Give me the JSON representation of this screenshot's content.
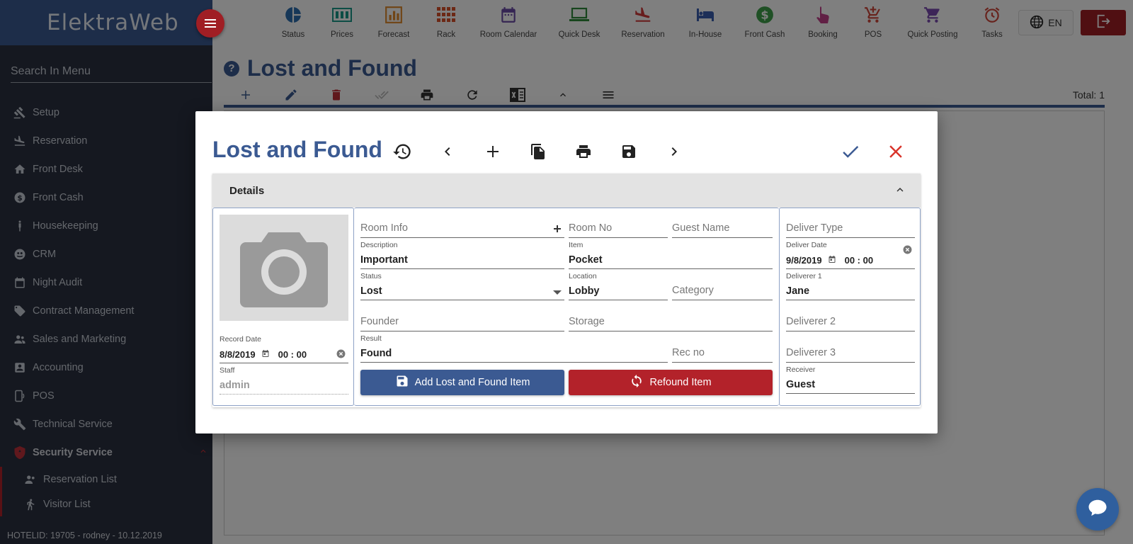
{
  "brand": {
    "name": "ElektraWeb"
  },
  "sidebar": {
    "search_placeholder": "Search In Menu",
    "items": [
      {
        "label": "Setup",
        "icon": "gavel-icon"
      },
      {
        "label": "Reservation",
        "icon": "plane-landing-icon"
      },
      {
        "label": "Front Desk",
        "icon": "home-icon"
      },
      {
        "label": "Front Cash",
        "icon": "dollar-icon"
      },
      {
        "label": "Housekeeping",
        "icon": "person-icon"
      },
      {
        "label": "CRM",
        "icon": "globe-icon"
      },
      {
        "label": "Night Audit",
        "icon": "calendar-icon"
      },
      {
        "label": "Contract Management",
        "icon": "tag-icon"
      },
      {
        "label": "Sales and Marketing",
        "icon": "people-icon"
      },
      {
        "label": "Accounting",
        "icon": "account-box-icon"
      },
      {
        "label": "POS",
        "icon": "pos-device-icon"
      },
      {
        "label": "Technical Service",
        "icon": "wrench-icon"
      },
      {
        "label": "Security Service",
        "icon": "shield-icon"
      }
    ],
    "sub_items": [
      {
        "label": "Reservation List",
        "icon": "people-icon"
      },
      {
        "label": "Visitor List",
        "icon": "walking-person-icon"
      }
    ],
    "hotel_info": "HOTELID: 19705 - rodney - 10.12.2019"
  },
  "topnav": {
    "items": [
      {
        "label": "Status",
        "icon": "pie-chart-icon",
        "color": "#2d6fb0"
      },
      {
        "label": "Prices",
        "icon": "cash-register-icon",
        "color": "#1a9a8a"
      },
      {
        "label": "Forecast",
        "icon": "bar-chart-icon",
        "color": "#e08a2c"
      },
      {
        "label": "Rack",
        "icon": "grid-icon",
        "color": "#d8502a"
      },
      {
        "label": "Room Calendar",
        "icon": "calendar-icon",
        "color": "#6a4aa6"
      },
      {
        "label": "Quick Desk",
        "icon": "laptop-icon",
        "color": "#2e8a3a"
      },
      {
        "label": "Reservation",
        "icon": "plane-landing-icon",
        "color": "#d03a3a"
      },
      {
        "label": "In-House",
        "icon": "bed-icon",
        "color": "#3b5fb0"
      },
      {
        "label": "Front Cash",
        "icon": "dollar-icon",
        "color": "#3ea04a"
      },
      {
        "label": "Booking",
        "icon": "hand-pointer-icon",
        "color": "#c2408a"
      },
      {
        "label": "POS",
        "icon": "cart-plus-icon",
        "color": "#d0463a"
      },
      {
        "label": "Quick Posting",
        "icon": "cart-icon",
        "color": "#7a4ab0"
      },
      {
        "label": "Tasks",
        "icon": "alarm-clock-icon",
        "color": "#d0463a"
      }
    ],
    "language": "EN"
  },
  "page": {
    "title": "Lost and Found",
    "total": "Total: 1"
  },
  "modal": {
    "title": "Lost and Found",
    "section_title": "Details",
    "record_date": {
      "label": "Record Date",
      "date": "8/8/2019",
      "time": "00 : 00"
    },
    "staff": {
      "label": "Staff",
      "value": "admin"
    },
    "room_info": {
      "placeholder": "Room Info"
    },
    "room_no": {
      "placeholder": "Room No"
    },
    "guest_name": {
      "placeholder": "Guest Name"
    },
    "description": {
      "label": "Description",
      "value": "Important"
    },
    "item": {
      "label": "Item",
      "value": "Pocket"
    },
    "status": {
      "label": "Status",
      "value": "Lost"
    },
    "location": {
      "label": "Location",
      "value": "Lobby"
    },
    "category": {
      "placeholder": "Category"
    },
    "founder": {
      "placeholder": "Founder"
    },
    "storage": {
      "placeholder": "Storage"
    },
    "result": {
      "label": "Result",
      "value": "Found"
    },
    "rec_no": {
      "placeholder": "Rec no"
    },
    "deliver_type": {
      "placeholder": "Deliver Type"
    },
    "deliver_date": {
      "label": "Deliver Date",
      "date": "9/8/2019",
      "time": "00 : 00"
    },
    "deliverer1": {
      "label": "Deliverer 1",
      "value": "Jane"
    },
    "deliverer2": {
      "placeholder": "Deliverer 2"
    },
    "deliverer3": {
      "placeholder": "Deliverer 3"
    },
    "receiver": {
      "label": "Receiver",
      "value": "Guest"
    },
    "add_button": "Add Lost and Found Item",
    "refound_button": "Refound Item"
  },
  "colors": {
    "primary": "#3b5a92",
    "danger": "#b3222a",
    "sidebar_bg": "#2b3140"
  }
}
